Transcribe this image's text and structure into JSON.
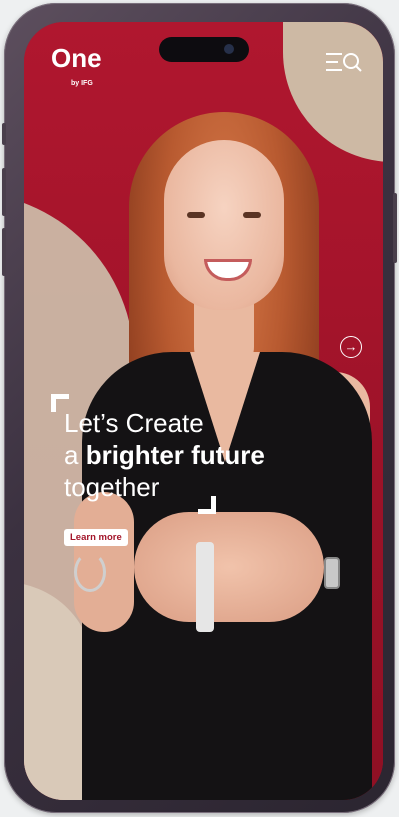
{
  "brand": {
    "logo_word": "One",
    "logo_sub": "by IFG"
  },
  "header": {
    "menu_icon": "menu-search-icon"
  },
  "hero": {
    "line1": "Let’s Create",
    "line2_prefix": "a ",
    "line2_bold": "brighter future",
    "line3": "together",
    "cta_label": "Learn more",
    "next_icon": "arrow-right-circle-icon"
  },
  "colors": {
    "brand": "#a3152a",
    "accent_beige": "#cdb9a4",
    "text": "#ffffff"
  }
}
